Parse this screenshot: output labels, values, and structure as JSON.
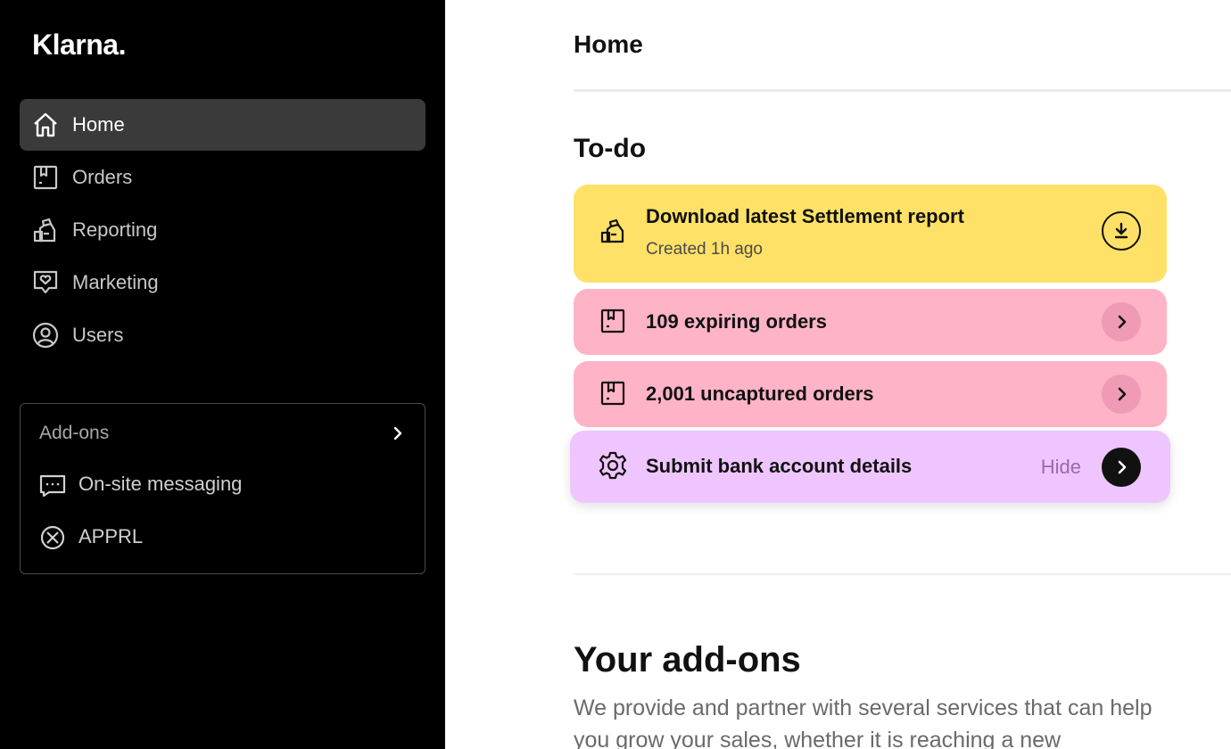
{
  "app": {
    "logo": "Klarna."
  },
  "sidebar": {
    "items": [
      {
        "label": "Home",
        "icon": "home-icon",
        "active": true
      },
      {
        "label": "Orders",
        "icon": "orders-icon",
        "active": false
      },
      {
        "label": "Reporting",
        "icon": "reporting-icon",
        "active": false
      },
      {
        "label": "Marketing",
        "icon": "marketing-icon",
        "active": false
      },
      {
        "label": "Users",
        "icon": "users-icon",
        "active": false
      }
    ],
    "addons": {
      "title": "Add-ons",
      "items": [
        {
          "label": "On-site messaging",
          "icon": "chat-bubble-icon"
        },
        {
          "label": "APPRL",
          "icon": "apprl-icon"
        }
      ]
    }
  },
  "main": {
    "title": "Home",
    "todo": {
      "title": "To-do",
      "cards": [
        {
          "title": "Download latest Settlement report",
          "subtitle": "Created 1h ago",
          "icon": "money-bag-icon",
          "action_icon": "download-icon",
          "color": "#ffe167"
        },
        {
          "title": "109 expiring orders",
          "icon": "orders-icon",
          "action_icon": "chevron-right-icon",
          "color": "#ffb3c7"
        },
        {
          "title": "2,001 uncaptured orders",
          "icon": "orders-icon",
          "action_icon": "chevron-right-icon",
          "color": "#ffb3c7"
        },
        {
          "title": "Submit bank account details",
          "icon": "gear-icon",
          "hide_label": "Hide",
          "action_icon": "chevron-right-icon",
          "color": "#efc5ff"
        }
      ]
    },
    "addons_section": {
      "heading": "Your add-ons",
      "text": "We provide and partner with several services that can help you grow your sales, whether it is reaching a new"
    }
  }
}
